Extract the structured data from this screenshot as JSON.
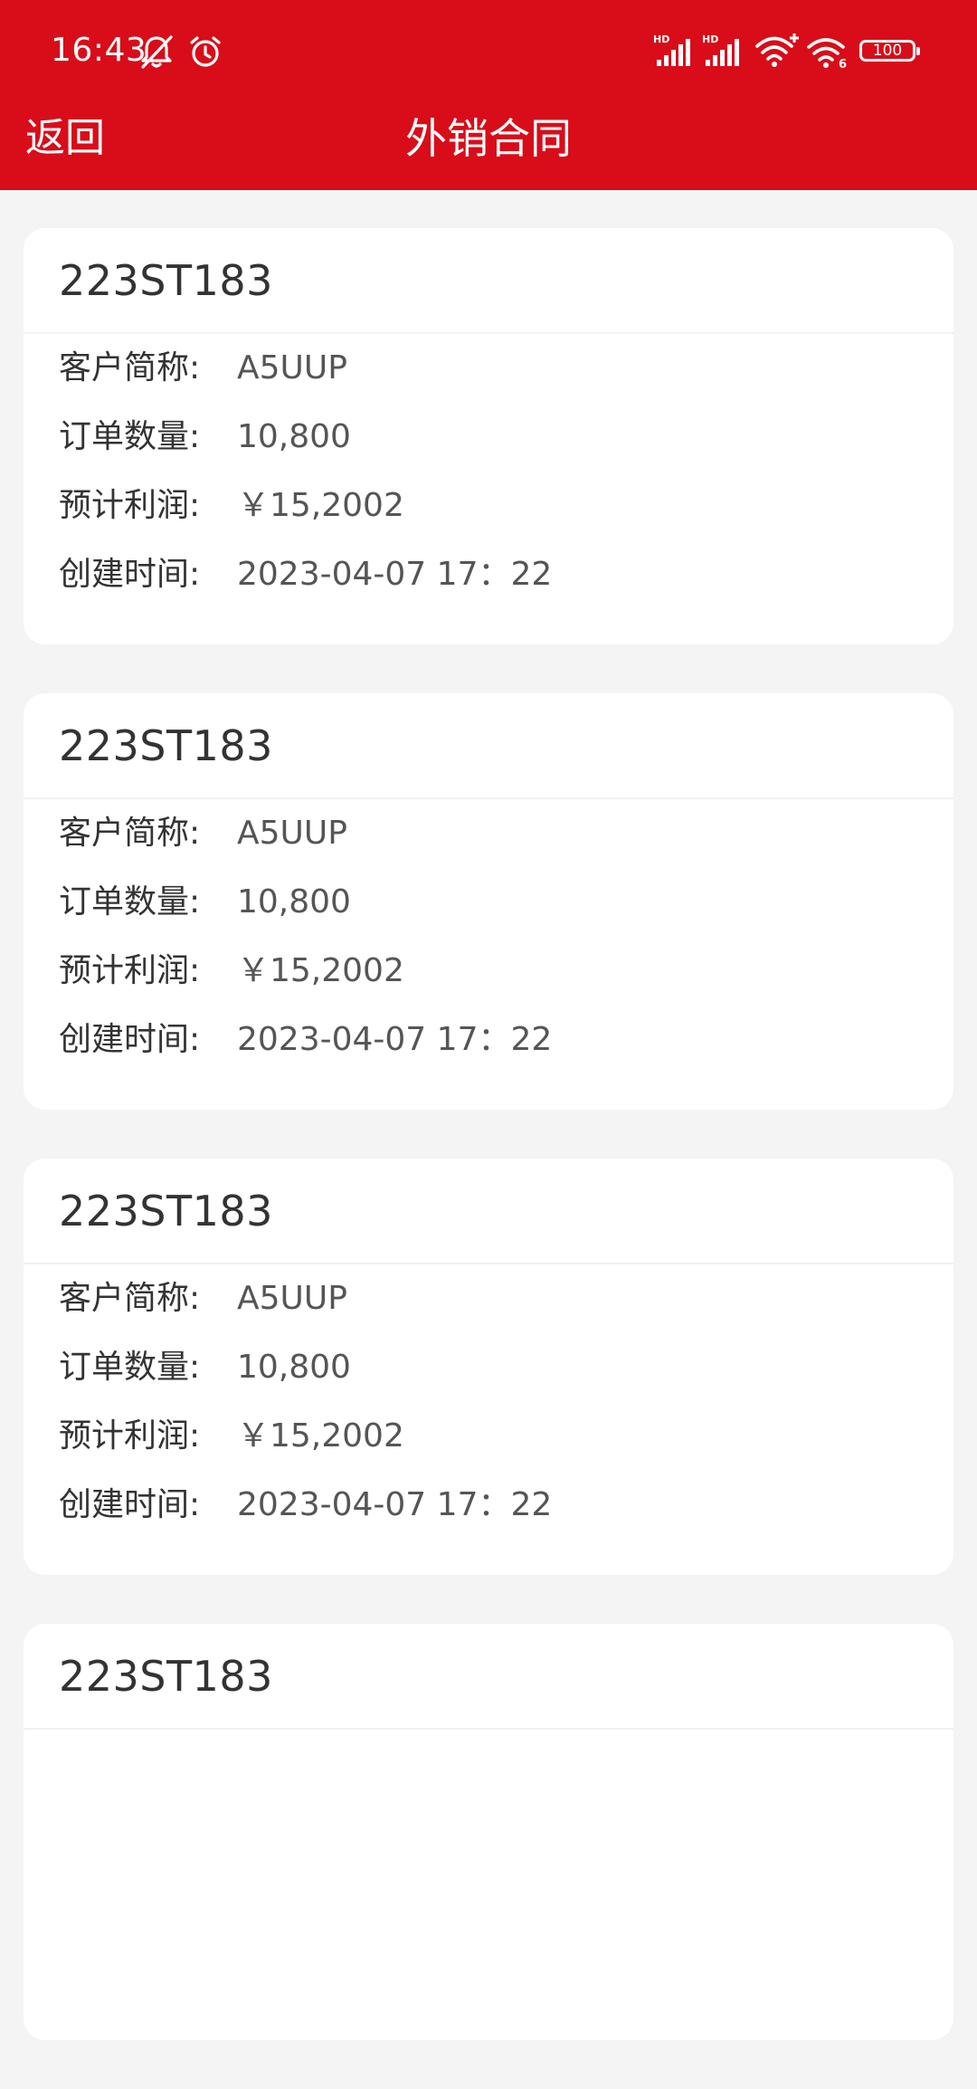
{
  "status_bar": {
    "time": "16:43",
    "battery": "100",
    "icons": [
      "mute-icon",
      "alarm-icon",
      "hd-signal-icon",
      "hd-signal-icon",
      "wifi-plus-icon",
      "wifi-6-icon",
      "battery-icon"
    ]
  },
  "header": {
    "back_label": "返回",
    "title": "外销合同",
    "background_color": "#d80d19"
  },
  "contracts": [
    {
      "contract_no": "223ST183",
      "customer_label": "客户简称:",
      "customer_value": "A5UUP",
      "quantity_label": "订单数量:",
      "quantity_value": "10,800",
      "profit_label": "预计利润:",
      "profit_value": "￥15,2002",
      "created_label": "创建时间:",
      "created_value": "2023-04-07 17：22"
    },
    {
      "contract_no": "223ST183",
      "customer_label": "客户简称:",
      "customer_value": "A5UUP",
      "quantity_label": "订单数量:",
      "quantity_value": "10,800",
      "profit_label": "预计利润:",
      "profit_value": "￥15,2002",
      "created_label": "创建时间:",
      "created_value": "2023-04-07 17：22"
    },
    {
      "contract_no": "223ST183",
      "customer_label": "客户简称:",
      "customer_value": "A5UUP",
      "quantity_label": "订单数量:",
      "quantity_value": "10,800",
      "profit_label": "预计利润:",
      "profit_value": "￥15,2002",
      "created_label": "创建时间:",
      "created_value": "2023-04-07 17：22"
    },
    {
      "contract_no": "223ST183"
    }
  ]
}
